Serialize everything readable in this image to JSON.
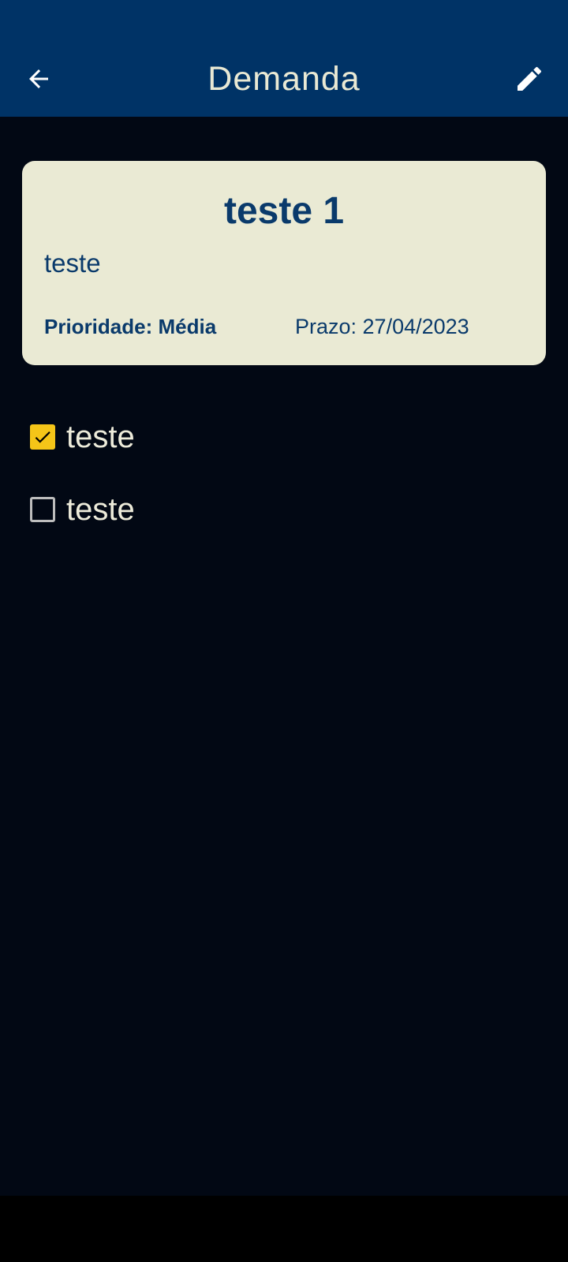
{
  "colors": {
    "appbar": "#003366",
    "background": "#020814",
    "card": "#EAEAD4",
    "card_text": "#0A3A6B",
    "checkbox_checked": "#F5C518",
    "checkbox_unchecked_border": "#BDBDBD",
    "item_text": "#EDEBDA",
    "nav_bar": "#000000"
  },
  "appbar": {
    "title": "Demanda",
    "back_icon": "arrow-left-icon",
    "edit_icon": "pencil-icon"
  },
  "card": {
    "title": "teste 1",
    "description": "teste",
    "priority": "Prioridade: Média",
    "deadline": "Prazo: 27/04/2023"
  },
  "checklist": [
    {
      "label": "teste",
      "checked": true
    },
    {
      "label": "teste",
      "checked": false
    }
  ]
}
